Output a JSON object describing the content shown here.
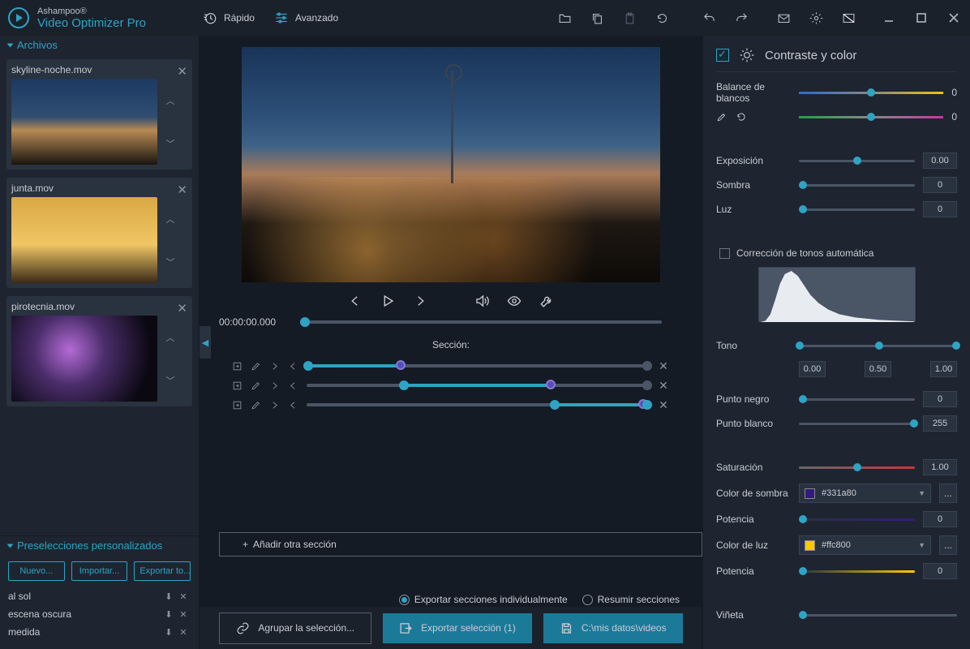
{
  "app": {
    "brand": "Ashampoo®",
    "product": "Video Optimizer Pro"
  },
  "modes": {
    "quick": "Rápido",
    "advanced": "Avanzado"
  },
  "sidebar": {
    "files_header": "Archivos",
    "files": [
      {
        "name": "skyline-noche.mov"
      },
      {
        "name": "junta.mov"
      },
      {
        "name": "pirotecnia.mov"
      }
    ],
    "presets_header": "Preselecciones personalizados",
    "preset_buttons": {
      "new": "Nuevo...",
      "import": "Importar...",
      "export": "Exportar to..."
    },
    "preset_items": [
      "al sol",
      "escena oscura",
      "medida"
    ]
  },
  "preview": {
    "time": "00:00:00.000",
    "section_label": "Sección:"
  },
  "actions": {
    "add_section": "Añadir otra sección",
    "export_indiv": "Exportar secciones individualmente",
    "summarize": "Resumir secciones",
    "group": "Agrupar la selección...",
    "export_sel": "Exportar selección (1)",
    "export_path": "C:\\mis datos\\videos"
  },
  "panel": {
    "title": "Contraste y color",
    "white_balance": "Balance de blancos",
    "wb_val": "0",
    "wb2_val": "0",
    "exposure": "Exposición",
    "exposure_val": "0.00",
    "shadow": "Sombra",
    "shadow_val": "0",
    "light": "Luz",
    "light_val": "0",
    "auto_tone": "Corrección de tonos automática",
    "tone": "Tono",
    "tone_v1": "0.00",
    "tone_v2": "0.50",
    "tone_v3": "1.00",
    "black": "Punto negro",
    "black_val": "0",
    "white": "Punto blanco",
    "white_val": "255",
    "saturation": "Saturación",
    "saturation_val": "1.00",
    "shadow_color": "Color de sombra",
    "shadow_hex": "#331a80",
    "power": "Potencia",
    "power_val": "0",
    "light_color": "Color de luz",
    "light_hex": "#ffc800",
    "power2": "Potencia",
    "power2_val": "0",
    "vignette": "Viñeta"
  }
}
